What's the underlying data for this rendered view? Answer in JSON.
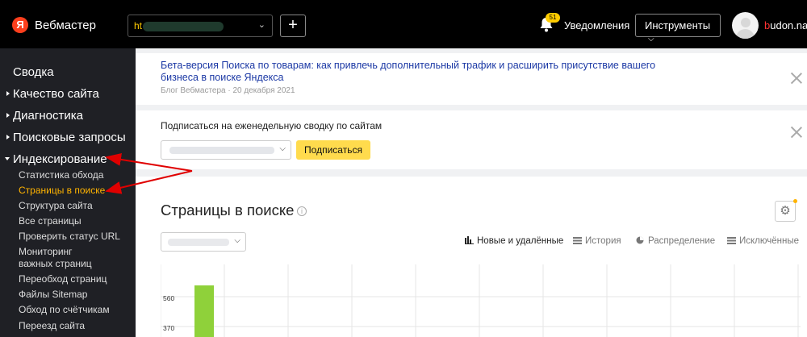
{
  "header": {
    "logo_letter": "Я",
    "logo_text": "Вебмастер",
    "site_select_value": "ht",
    "plus_label": "+",
    "notifications_count": "51",
    "notifications_label": "Уведомления",
    "tools_label": "Инструменты",
    "username_first": "b",
    "username_rest": "udon.nata"
  },
  "sidebar": {
    "items": [
      {
        "label": "Сводка"
      },
      {
        "label": "Качество сайта"
      },
      {
        "label": "Диагностика"
      },
      {
        "label": "Поисковые запросы"
      },
      {
        "label": "Индексирование"
      }
    ],
    "sub_items": [
      {
        "label": "Статистика обхода"
      },
      {
        "label": "Страницы в поиске"
      },
      {
        "label": "Структура сайта"
      },
      {
        "label": "Все страницы"
      },
      {
        "label": "Проверить статус URL"
      },
      {
        "label": "Мониторинг"
      },
      {
        "label": "важных страниц"
      },
      {
        "label": "Переобход страниц"
      },
      {
        "label": "Файлы Sitemap"
      },
      {
        "label": "Обход по счётчикам"
      },
      {
        "label": "Переезд сайта"
      }
    ]
  },
  "blog_card": {
    "title": "Бета-версия Поиска по товарам: как привлечь дополнительный трафик и расширить присутствие вашего бизнеса в поиске Яндекса",
    "meta": "Блог Вебмастера · 20 декабря 2021"
  },
  "subscribe_card": {
    "title": "Подписаться на еженедельную сводку по сайтам",
    "button_label": "Подписаться"
  },
  "pages_card": {
    "title": "Страницы в поиске",
    "info_glyph": "i",
    "settings_glyph": "⚙",
    "tabs": [
      {
        "label": "Новые и удалённые",
        "icon": "bars-icon"
      },
      {
        "label": "История",
        "icon": "history-icon"
      },
      {
        "label": "Распределение",
        "icon": "pie-icon"
      },
      {
        "label": "Исключённые",
        "icon": "excluded-icon"
      }
    ]
  },
  "chart_data": {
    "type": "bar",
    "ticks": [
      "560",
      "370"
    ],
    "bar_color": "#8fd13a"
  },
  "colors": {
    "header_bg": "#000000",
    "sidebar_bg": "#1f2025",
    "active_nav": "#ffb300",
    "link": "#1c39a5",
    "button_yellow": "#ffdb4d",
    "arrow_red": "#e00000"
  }
}
